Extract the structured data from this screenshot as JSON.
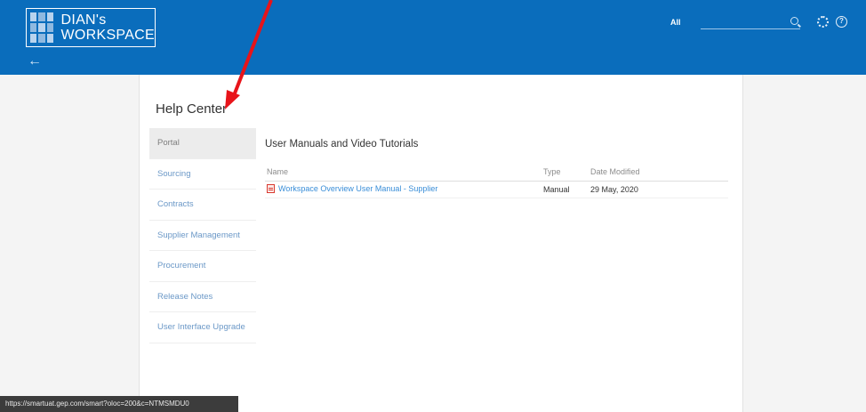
{
  "header": {
    "workspace_line1": "DIAN's",
    "workspace_line2": "WORKSPACE",
    "back_glyph": "←",
    "search_scope": "All",
    "search_placeholder": "",
    "icons": [
      "app-logo-icon",
      "back-arrow-icon",
      "search-icon",
      "gear-icon",
      "help-icon"
    ]
  },
  "page": {
    "title": "Help Center"
  },
  "nav": {
    "items": [
      {
        "label": "Portal",
        "active": true
      },
      {
        "label": "Sourcing"
      },
      {
        "label": "Contracts"
      },
      {
        "label": "Supplier Management"
      },
      {
        "label": "Procurement"
      },
      {
        "label": "Release Notes"
      },
      {
        "label": "User Interface Upgrade"
      }
    ]
  },
  "content": {
    "section_title": "User Manuals and Video Tutorials",
    "columns": [
      "Name",
      "Type",
      "Date Modified"
    ],
    "rows": [
      {
        "name": "Workspace Overview User Manual - Supplier",
        "type": "Manual",
        "date": "29 May, 2020",
        "icon": "pdf-icon"
      }
    ]
  },
  "status_bar": {
    "url": "https://smartuat.gep.com/smart?oloc=200&c=NTMSMDU0"
  },
  "colors": {
    "header_blue": "#0a6dbc",
    "link_blue": "#3a8ed8",
    "annotation_red": "#e8141a"
  }
}
